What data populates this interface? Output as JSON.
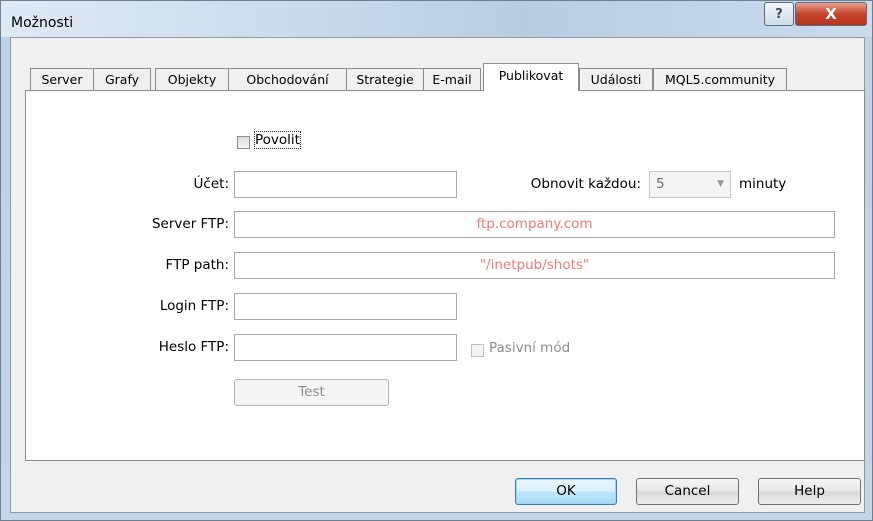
{
  "window": {
    "title": "Možnosti",
    "help_glyph": "?",
    "close_glyph": "X"
  },
  "tabs": [
    {
      "label": "Server",
      "active": false
    },
    {
      "label": "Grafy",
      "active": false
    },
    {
      "label": "Objekty",
      "active": false
    },
    {
      "label": "Obchodování",
      "active": false
    },
    {
      "label": "Strategie",
      "active": false
    },
    {
      "label": "E-mail",
      "active": false
    },
    {
      "label": "Publikovat",
      "active": true
    },
    {
      "label": "Události",
      "active": false
    },
    {
      "label": "MQL5.community",
      "active": false
    }
  ],
  "form": {
    "enable_label": "Povolit",
    "account_label": "Účet:",
    "account_value": "",
    "refresh_label": "Obnovit každou:",
    "refresh_value": "5",
    "refresh_unit": "minuty",
    "ftp_server_label": "Server FTP:",
    "ftp_server_value": "ftp.company.com",
    "ftp_path_label": "FTP path:",
    "ftp_path_value": "\"/inetpub/shots\"",
    "ftp_login_label": "Login FTP:",
    "ftp_login_value": "",
    "ftp_password_label": "Heslo FTP:",
    "ftp_password_value": "",
    "passive_mode_label": "Pasivní mód",
    "test_button_label": "Test"
  },
  "footer": {
    "ok_label": "OK",
    "cancel_label": "Cancel",
    "help_label": "Help"
  },
  "colors": {
    "placeholder_value": "#f07a7a",
    "default_button_border": "#3c7fb1"
  }
}
